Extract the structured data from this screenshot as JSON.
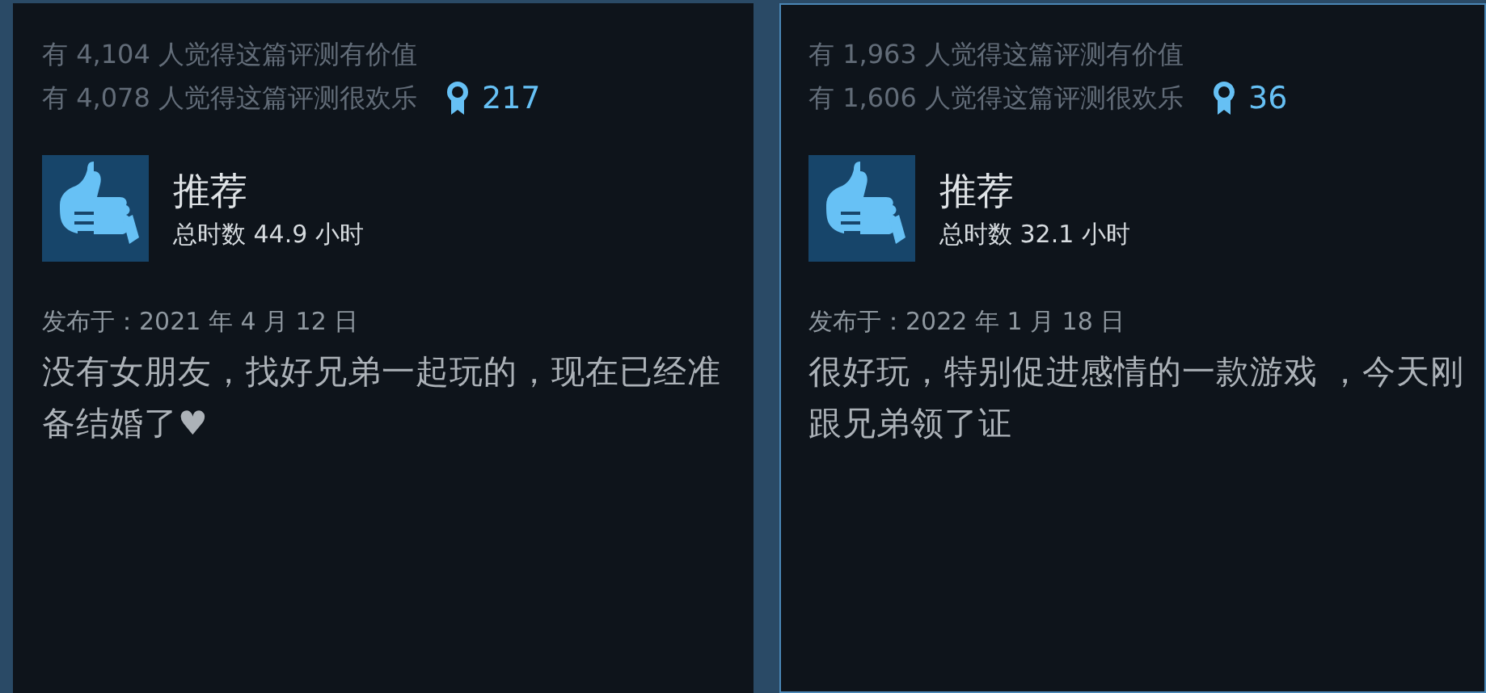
{
  "reviews": [
    {
      "helpful": "有 4,104 人觉得这篇评测有价值",
      "funny": "有 4,078 人觉得这篇评测很欢乐",
      "awards": "217",
      "recommended": true,
      "verdict": "推荐",
      "hours": "总时数 44.9 小时",
      "posted": "发布于：2021 年 4 月 12 日",
      "body": "没有女朋友，找好兄弟一起玩的，现在已经准备结婚了♥",
      "highlighted": false
    },
    {
      "helpful": "有 1,963 人觉得这篇评测有价值",
      "funny": "有 1,606 人觉得这篇评测很欢乐",
      "awards": "36",
      "recommended": true,
      "verdict": "推荐",
      "hours": "总时数 32.1 小时",
      "posted": "发布于：2022 年 1 月 18 日",
      "body": "很好玩，特别促进感情的一款游戏 ，今天刚跟兄弟领了证",
      "highlighted": true
    }
  ]
}
